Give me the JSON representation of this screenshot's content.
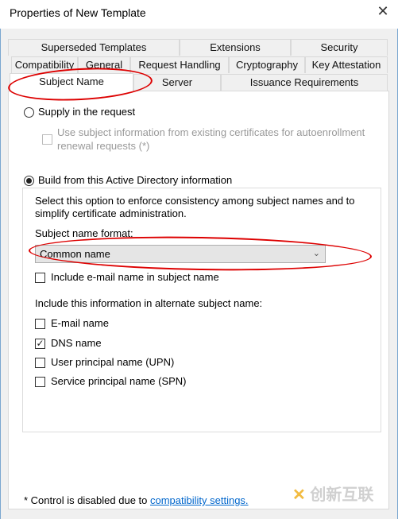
{
  "window": {
    "title": "Properties of New Template",
    "close_icon": "close-icon"
  },
  "tabs": {
    "row1": [
      "Superseded Templates",
      "Extensions",
      "Security"
    ],
    "row2": [
      "Compatibility",
      "General",
      "Request Handling",
      "Cryptography",
      "Key Attestation"
    ],
    "row3": [
      "Subject Name",
      "Server",
      "Issuance Requirements"
    ],
    "selected": "Subject Name"
  },
  "subject": {
    "supply_label": "Supply in the request",
    "supply_selected": false,
    "autoenroll_label_1": "Use subject information from existing certificates for autoenrollment",
    "autoenroll_label_2": "renewal requests (*)",
    "autoenroll_checked": false,
    "build_label": "Build from this Active Directory information",
    "build_selected": true,
    "desc_1": "Select this option to enforce consistency among subject names and to",
    "desc_2": "simplify certificate administration.",
    "format_label": "Subject name format:",
    "format_value": "Common name",
    "include_email_label": "Include e-mail name in subject name",
    "include_email_checked": false,
    "alt_heading": "Include this information in alternate subject name:",
    "alt_options": [
      {
        "label": "E-mail name",
        "checked": false
      },
      {
        "label": "DNS name",
        "checked": true
      },
      {
        "label": "User principal name (UPN)",
        "checked": false
      },
      {
        "label": "Service principal name (SPN)",
        "checked": false
      }
    ],
    "footnote": "* Control is disabled due to ",
    "footnote_link": "compatibility settings."
  },
  "watermark": "创新互联",
  "annotation_color": "#dd0000"
}
